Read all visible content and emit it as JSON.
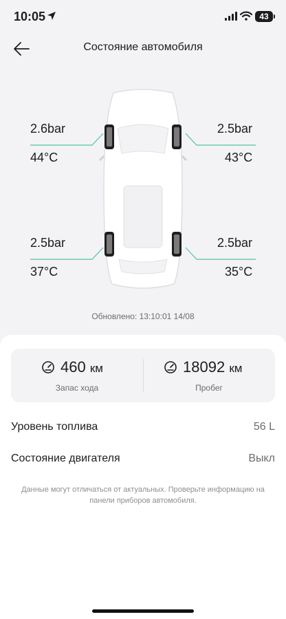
{
  "status_bar": {
    "time": "10:05",
    "battery": "43"
  },
  "header": {
    "title": "Состояние автомобиля"
  },
  "tires": {
    "front_left": {
      "pressure": "2.6bar",
      "temperature": "44°C"
    },
    "front_right": {
      "pressure": "2.5bar",
      "temperature": "43°C"
    },
    "rear_left": {
      "pressure": "2.5bar",
      "temperature": "37°C"
    },
    "rear_right": {
      "pressure": "2.5bar",
      "temperature": "35°C"
    }
  },
  "updated": "Обновлено: 13:10:01 14/08",
  "stats": {
    "range": {
      "value": "460",
      "unit": "км",
      "label": "Запас хода"
    },
    "mileage": {
      "value": "18092",
      "unit": "км",
      "label": "Пробег"
    }
  },
  "info": {
    "fuel_level": {
      "label": "Уровень топлива",
      "value": "56 L"
    },
    "engine_state": {
      "label": "Состояние двигателя",
      "value": "Выкл"
    }
  },
  "disclaimer": "Данные могут отличаться от актуальных. Проверьте информацию на панели приборов автомобиля.",
  "colors": {
    "accent_line": "#4fc3a1",
    "sheet_background": "#ffffff",
    "page_background": "#f3f3f6"
  }
}
